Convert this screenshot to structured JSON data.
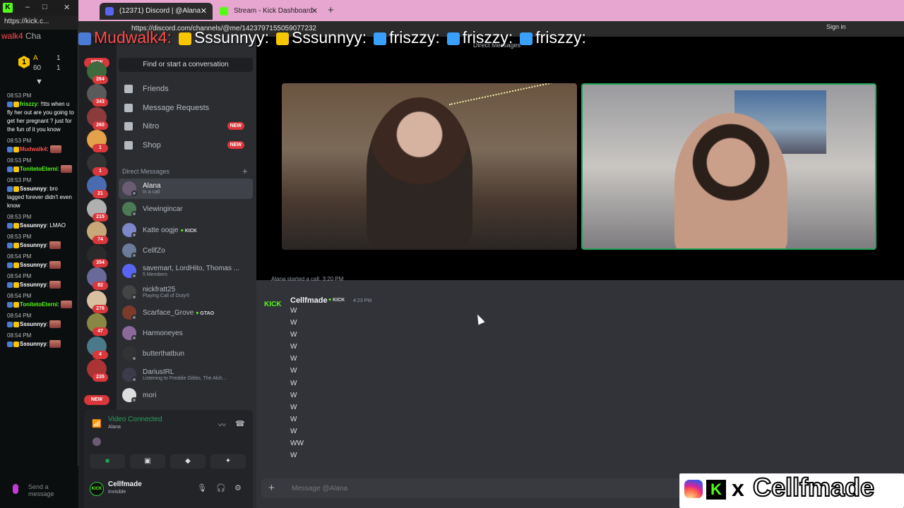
{
  "kick_chat": {
    "url": "https://kick.c...",
    "header_fragment": "walk4",
    "header_rest": "Cha",
    "leader_a": "A",
    "leader_b": "60",
    "leader_c": "1",
    "leader_d": "1",
    "badge_num": "1",
    "send_placeholder": "Send a message",
    "messages": [
      {
        "time": "08:53 PM",
        "user": "friszzy",
        "user_color": "#53fc18",
        "text": ": !!tts when u fly her out are you going to get her pregnant ? just for the fun of it you know",
        "emote": false
      },
      {
        "time": "08:53 PM",
        "user": "Mudwalk4",
        "user_color": "#ff4d4d",
        "text": ":",
        "emote": true
      },
      {
        "time": "08:53 PM",
        "user": "TonitetoEterni",
        "user_color": "#53fc18",
        "text": ":",
        "emote": true
      },
      {
        "time": "08:53 PM",
        "user": "Sssunnyy",
        "user_color": "#ffffff",
        "text": ": bro lagged forever didn't even know",
        "emote": false
      },
      {
        "time": "08:53 PM",
        "user": "Sssunnyy",
        "user_color": "#ffffff",
        "text": ": LMAO",
        "emote": false
      },
      {
        "time": "08:53 PM",
        "user": "Sssunnyy",
        "user_color": "#ffffff",
        "text": ":",
        "emote": true
      },
      {
        "time": "08:54 PM",
        "user": "Sssunnyy",
        "user_color": "#ffffff",
        "text": ":",
        "emote": true
      },
      {
        "time": "08:54 PM",
        "user": "Sssunnyy",
        "user_color": "#ffffff",
        "text": ":",
        "emote": true
      },
      {
        "time": "08:54 PM",
        "user": "TonitetoEterni",
        "user_color": "#53fc18",
        "text": ":",
        "emote": true
      },
      {
        "time": "08:54 PM",
        "user": "Sssunnyy",
        "user_color": "#ffffff",
        "text": ":",
        "emote": true
      },
      {
        "time": "08:54 PM",
        "user": "Sssunnyy",
        "user_color": "#ffffff",
        "text": ":",
        "emote": true
      }
    ]
  },
  "browser": {
    "tabs": [
      {
        "label": "(12371) Discord | @Alana",
        "active": true
      },
      {
        "label": "Stream - Kick Dashboard",
        "active": false
      }
    ],
    "new_tab": "+",
    "url": "https://discord.com/channels/@me/1423797155059077232",
    "sign_in": "Sign in"
  },
  "ticker": {
    "items": [
      "Mudwalk4:",
      "Sssunnyy:",
      "Sssunnyy:",
      "friszzy:",
      "friszzy:",
      "friszzy:"
    ]
  },
  "discord": {
    "server_badges": [
      "NEW",
      "264",
      "343",
      "260",
      "1",
      "1",
      "21",
      "215",
      "74",
      "354",
      "82",
      "276",
      "47",
      "4",
      "235",
      "NEW"
    ],
    "search_placeholder": "Find or start a conversation",
    "nav": [
      {
        "label": "Friends",
        "new": false
      },
      {
        "label": "Message Requests",
        "new": false
      },
      {
        "label": "Nitro",
        "new": true
      },
      {
        "label": "Shop",
        "new": true
      }
    ],
    "new_label": "NEW",
    "dm_header": "Direct Messages",
    "dm_add": "+",
    "dms": [
      {
        "name": "Alana",
        "sub": "In a call",
        "tag": "",
        "color": "#6b5b73",
        "active": true
      },
      {
        "name": "Viewingincar",
        "sub": "",
        "tag": "",
        "color": "#4b7a55",
        "active": false
      },
      {
        "name": "Katte oogje",
        "sub": "",
        "tag": "KICK",
        "color": "#7d88c9",
        "active": false
      },
      {
        "name": "CellfZo",
        "sub": "",
        "tag": "",
        "color": "#6a7c99",
        "active": false
      },
      {
        "name": "savemart, LordHito, Thomas ...",
        "sub": "5 Members",
        "tag": "",
        "color": "#5865f2",
        "active": false
      },
      {
        "name": "nickfratt25",
        "sub": "Playing Call of Duty®",
        "tag": "",
        "color": "#444",
        "active": false
      },
      {
        "name": "Scarface_Grove",
        "sub": "",
        "tag": "GTAO",
        "color": "#7a3b2b",
        "active": false
      },
      {
        "name": "Harmoneyes",
        "sub": "",
        "tag": "",
        "color": "#8b6a9a",
        "active": false
      },
      {
        "name": "butterthatbun",
        "sub": "",
        "tag": "",
        "color": "#333",
        "active": false
      },
      {
        "name": "DariusIRL",
        "sub": "Listening to Freddie Gibbs, The Alch...",
        "tag": "",
        "color": "#3b3b4b",
        "active": false
      },
      {
        "name": "mori",
        "sub": "",
        "tag": "",
        "color": "#ddd",
        "active": false
      }
    ],
    "voice": {
      "title": "Video Connected",
      "sub": "Alana"
    },
    "user": {
      "name": "Cellfmade",
      "status": "Invisible",
      "avatar_text": "KICK"
    },
    "call_title": "Direct Messages",
    "partial_system": "Alana started a call. 3:20 PM",
    "message": {
      "author": "Cellfmade",
      "tag": "KICK",
      "time": "4:23 PM",
      "avatar_text": "KICK",
      "lines": [
        "W",
        "W",
        "W",
        "W",
        "W",
        "W",
        "W",
        "W",
        "W",
        "W",
        "W",
        "WW",
        "W"
      ]
    },
    "composer_placeholder": "Message @Alana"
  },
  "branding": {
    "x": "x",
    "name": "Cellfmade",
    "k": "K"
  }
}
